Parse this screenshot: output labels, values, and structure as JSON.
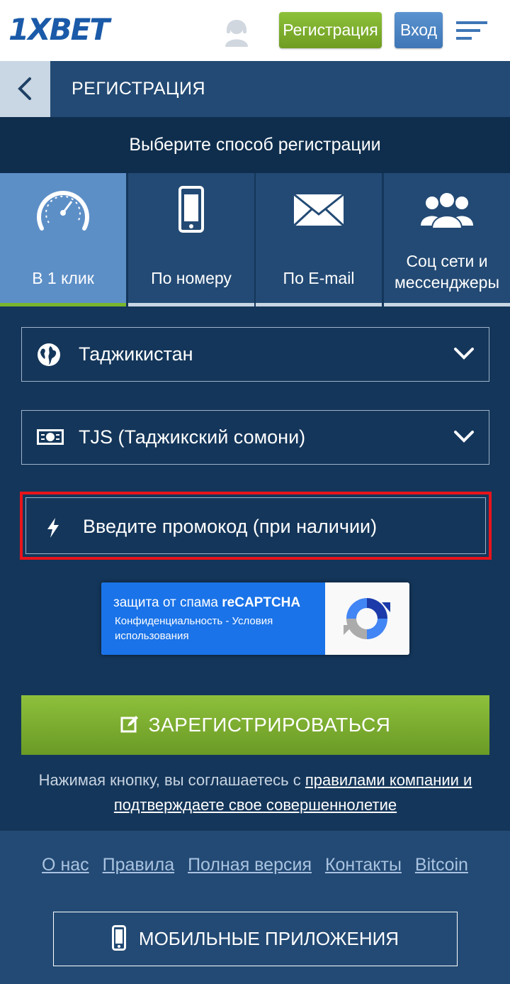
{
  "header": {
    "logo": {
      "one": "1",
      "x": "X",
      "bet": "BET"
    },
    "register_label": "Регистрация",
    "login_label": "Вход"
  },
  "titlebar": {
    "title": "РЕГИСТРАЦИЯ"
  },
  "methods": {
    "heading": "Выберите способ регистрации",
    "tabs": [
      {
        "label": "В 1 клик",
        "icon": "speedometer-icon",
        "active": true
      },
      {
        "label": "По номеру",
        "icon": "phone-icon",
        "active": false
      },
      {
        "label": "По E-mail",
        "icon": "envelope-icon",
        "active": false
      },
      {
        "label": "Соц сети и мессенджеры",
        "icon": "people-icon",
        "active": false
      }
    ]
  },
  "form": {
    "country": "Таджикистан",
    "currency": "TJS (Таджикский сомони)",
    "promo_placeholder": "Введите промокод (при наличии)",
    "recaptcha": {
      "title_prefix": "защита от спама ",
      "title_brand": "reCAPTCHA",
      "links": "Конфиденциальность - Условия использования"
    },
    "submit_label": "ЗАРЕГИСТРИРОВАТЬСЯ",
    "agree_prefix": "Нажимая кнопку, вы соглашаетесь с ",
    "agree_link": "правилами компании и подтверждаете свое совершеннолетие"
  },
  "footer": {
    "links": [
      "О нас",
      "Правила",
      "Полная версия",
      "Контакты",
      "Bitcoin"
    ],
    "apps_label": "МОБИЛЬНЫЕ ПРИЛОЖЕНИЯ"
  },
  "colors": {
    "background": "#14365a",
    "accent_green": "#7ab52e",
    "active_tab": "#5d8fc7",
    "highlight_red": "#e8141b"
  }
}
